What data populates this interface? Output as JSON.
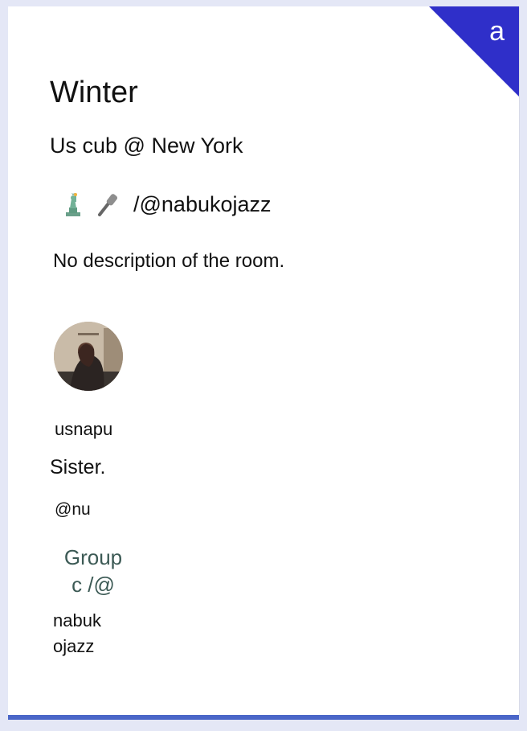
{
  "room": {
    "title": "Winter",
    "location": "Us cub @ New York",
    "handle": "/@nabukojazz",
    "description": "No description of the room."
  },
  "badge": {
    "letter": "a"
  },
  "member": {
    "username": "usnapu",
    "bio": "Sister.",
    "handle": "@nu",
    "group_label_line1": "Group",
    "group_label_line2": "c /@",
    "group_name_line1": "nabuk",
    "group_name_line2": "ojazz"
  },
  "icons": {
    "location_emoji": "statue-of-liberty-icon",
    "topic_emoji": "microphone-icon"
  },
  "colors": {
    "accent": "#2f2fc9",
    "bottom_bar": "#4a66c8",
    "background": "#e4e7f6"
  }
}
